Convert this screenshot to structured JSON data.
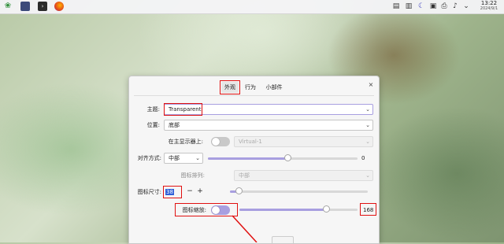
{
  "taskbar": {
    "clock_time": "13:22",
    "clock_date": "2024/9/1"
  },
  "dialog": {
    "tabs": [
      "外观",
      "行为",
      "小部件"
    ],
    "close_glyph": "×",
    "theme": {
      "label": "主题:",
      "value": "Transparent"
    },
    "position": {
      "label": "位置:",
      "value": "底部"
    },
    "primary_display": {
      "label": "在主显示器上:",
      "value": "Virtual-1"
    },
    "alignment": {
      "label": "对齐方式:",
      "value": "中部",
      "offset_value": "0"
    },
    "icon_arrange": {
      "label": "图标排列:",
      "value": "中部"
    },
    "icon_size": {
      "label": "图标尺寸:",
      "value": "38",
      "minus": "−",
      "plus": "+",
      "level": 0.06
    },
    "icon_zoom": {
      "label": "图标缩放:",
      "value": "168",
      "level": 0.73
    },
    "alignment_level": 0.53
  },
  "colors": {
    "accent": "#a89fe0",
    "highlight_red": "#e01010",
    "selection_blue": "#2f5fd8"
  }
}
